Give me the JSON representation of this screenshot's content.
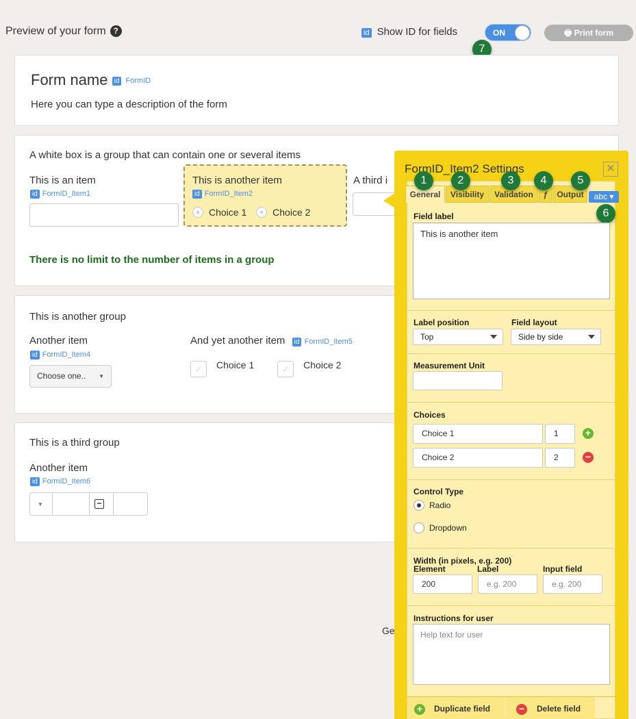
{
  "header": {
    "title": "Preview of your form",
    "help_icon": "question-circle-icon",
    "show_id_chip": "id",
    "show_id_label": "Show ID for fields",
    "toggle_label": "ON",
    "print_label": "Print form",
    "print_icon": "printer-icon"
  },
  "badges": [
    "1",
    "2",
    "3",
    "4",
    "5",
    "6",
    "7"
  ],
  "form_header": {
    "name": "Form name",
    "id_chip": "id",
    "id": "FormID",
    "description": "Here you can type a description of the form"
  },
  "group1": {
    "description": "A white box is a group that can contain one or several items",
    "item1_label": "This is an item",
    "item1_id": "FormID_Item1",
    "item2_label": "This is another item",
    "item2_id": "FormID_Item2",
    "item2_choice1": "Choice 1",
    "item2_choice2": "Choice 2",
    "item3_label": "A third i",
    "note": "There is no limit to the number of items in a group"
  },
  "group2": {
    "title": "This is another group",
    "item4_label": "Another item",
    "item4_id": "FormID_Item4",
    "item4_select": "Choose one..",
    "item5_label": "And yet another item",
    "item5_id": "FormID_Item5",
    "item5_choice1": "Choice 1",
    "item5_choice2": "Choice 2"
  },
  "group3": {
    "title": "This is a third group",
    "item6_label": "Another item",
    "item6_id": "FormID_Item6"
  },
  "background_partial_text": "Ge",
  "settings": {
    "title": "FormID_Item2 Settings",
    "close": "✕",
    "tabs": [
      "General",
      "Visibility",
      "Validation",
      "ƒ",
      "Output"
    ],
    "abc_tab": "abc ▾",
    "field_label_heading": "Field label",
    "field_label_value": "This is another item",
    "label_position_heading": "Label position",
    "label_position_value": "Top",
    "field_layout_heading": "Field layout",
    "field_layout_value": "Side by side",
    "measurement_unit_heading": "Measurement Unit",
    "choices_heading": "Choices",
    "choices": [
      {
        "label": "Choice 1",
        "value": "1",
        "action": "+"
      },
      {
        "label": "Choice 2",
        "value": "2",
        "action": "−"
      }
    ],
    "control_type_heading": "Control Type",
    "control_type_options": [
      "Radio",
      "Dropdown"
    ],
    "width_heading": "Width (in pixels, e.g. 200)",
    "width_element_heading": "Element",
    "width_label_heading": "Label",
    "width_input_heading": "Input field",
    "width_element_value": "200",
    "width_label_placeholder": "e.g. 200",
    "width_input_placeholder": "e.g. 200",
    "instructions_heading": "Instructions for user",
    "instructions_placeholder": "Help text for user",
    "duplicate_label": "Duplicate field",
    "delete_label": "Delete field"
  },
  "colors": {
    "accent_blue": "#4a90e2",
    "badge_green": "#1f7a3a",
    "panel_yellow": "#f5d216",
    "note_green": "#1e6b1e",
    "add_green": "#6bb52b",
    "delete_red": "#e0413d"
  }
}
